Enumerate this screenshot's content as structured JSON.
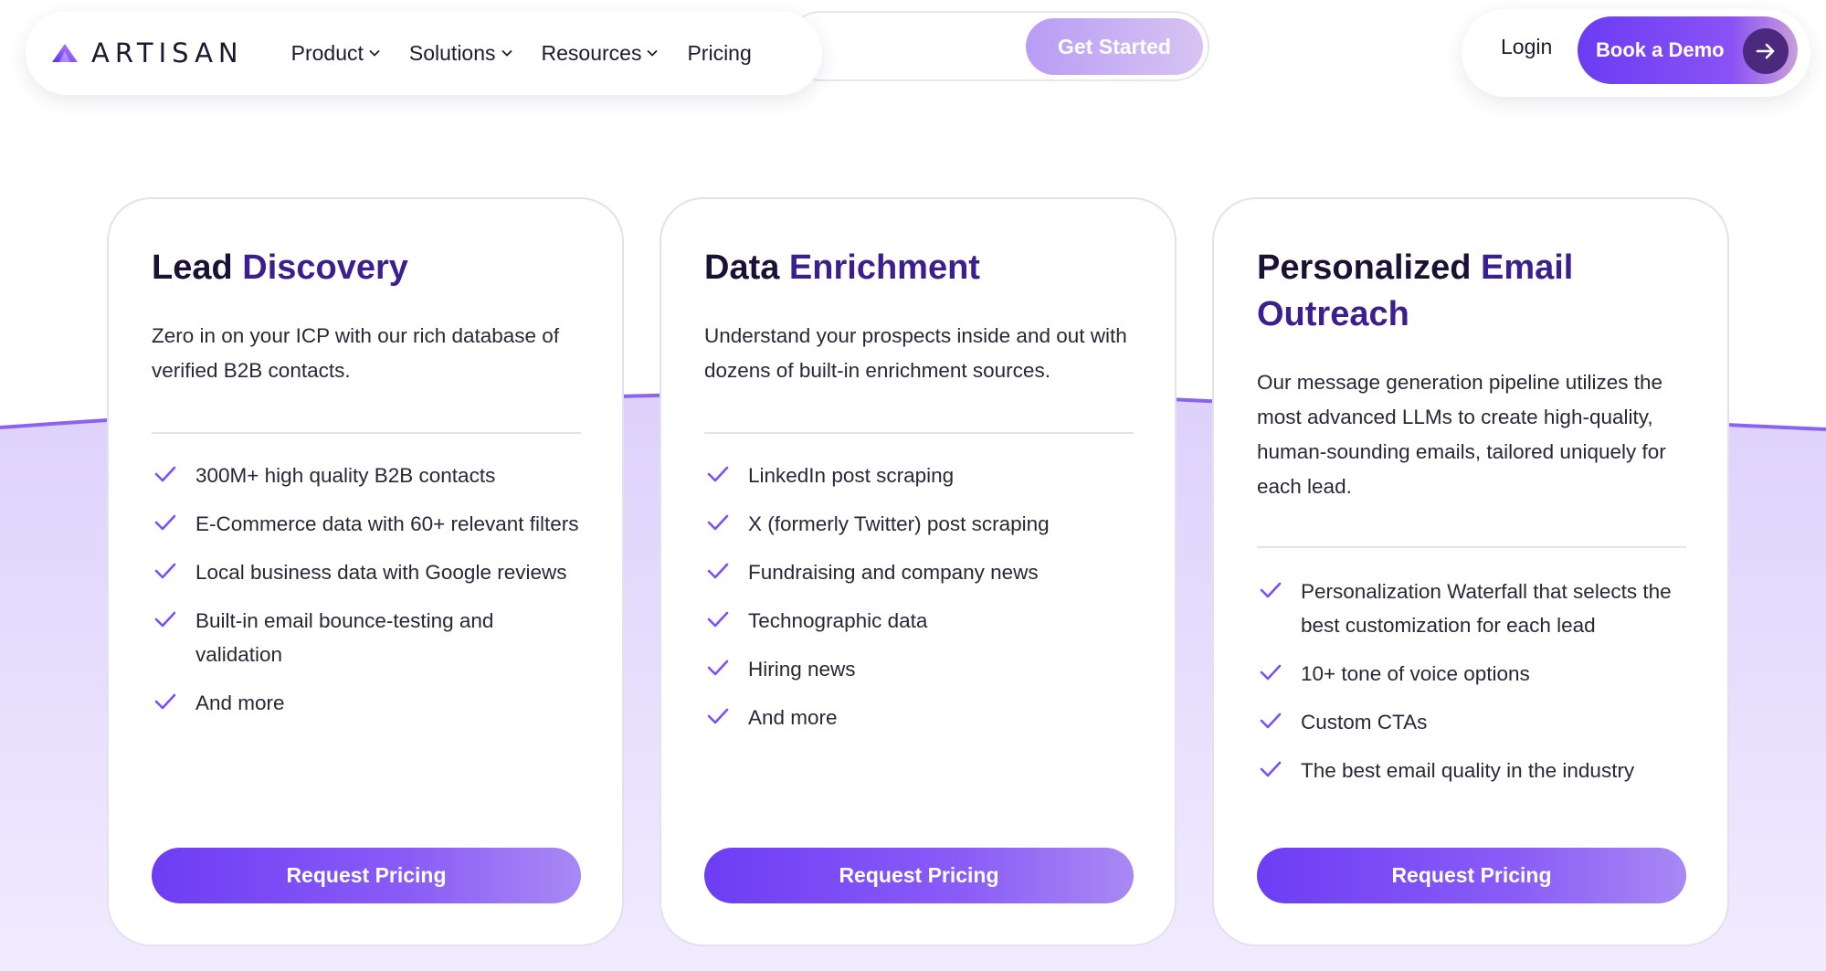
{
  "nav": {
    "logo_text": "ARTISAN",
    "items": [
      {
        "label": "Product",
        "has_dropdown": true
      },
      {
        "label": "Solutions",
        "has_dropdown": true
      },
      {
        "label": "Resources",
        "has_dropdown": true
      },
      {
        "label": "Pricing",
        "has_dropdown": false
      }
    ],
    "get_started_label": "Get Started",
    "login_label": "Login",
    "book_demo_label": "Book a Demo",
    "book_demo_icon": "arrow-right-icon"
  },
  "cards": [
    {
      "title_part1": "Lead ",
      "title_part2": "Discovery",
      "description": "Zero in on your ICP with our rich database of verified B2B contacts.",
      "features": [
        "300M+ high quality B2B contacts",
        "E-Commerce data with 60+ relevant filters",
        "Local business data with Google reviews",
        "Built-in email bounce-testing and validation",
        "And more"
      ],
      "button_label": "Request Pricing"
    },
    {
      "title_part1": "Data ",
      "title_part2": "Enrichment",
      "description": "Understand your prospects inside and out with dozens of built-in enrichment sources.",
      "features": [
        "LinkedIn post scraping",
        "X (formerly Twitter) post scraping",
        "Fundraising and company news",
        "Technographic data",
        "Hiring news",
        "And more"
      ],
      "button_label": "Request Pricing"
    },
    {
      "title_part1": "Personalized ",
      "title_part2": "Email Outreach",
      "description": "Our message generation pipeline utilizes the most advanced LLMs to create high-quality, human-sounding emails, tailored uniquely for each lead.",
      "features": [
        "Personalization Waterfall that selects the best customization for each lead",
        "10+ tone of voice options",
        "Custom CTAs",
        "The best email quality in the industry"
      ],
      "button_label": "Request Pricing"
    }
  ],
  "colors": {
    "brand_purple": "#6d3df4",
    "title_dark": "#1a1135",
    "title_accent": "#3b1f8f",
    "check_color": "#7c4dff",
    "background_lavender": "#e3dafb"
  }
}
